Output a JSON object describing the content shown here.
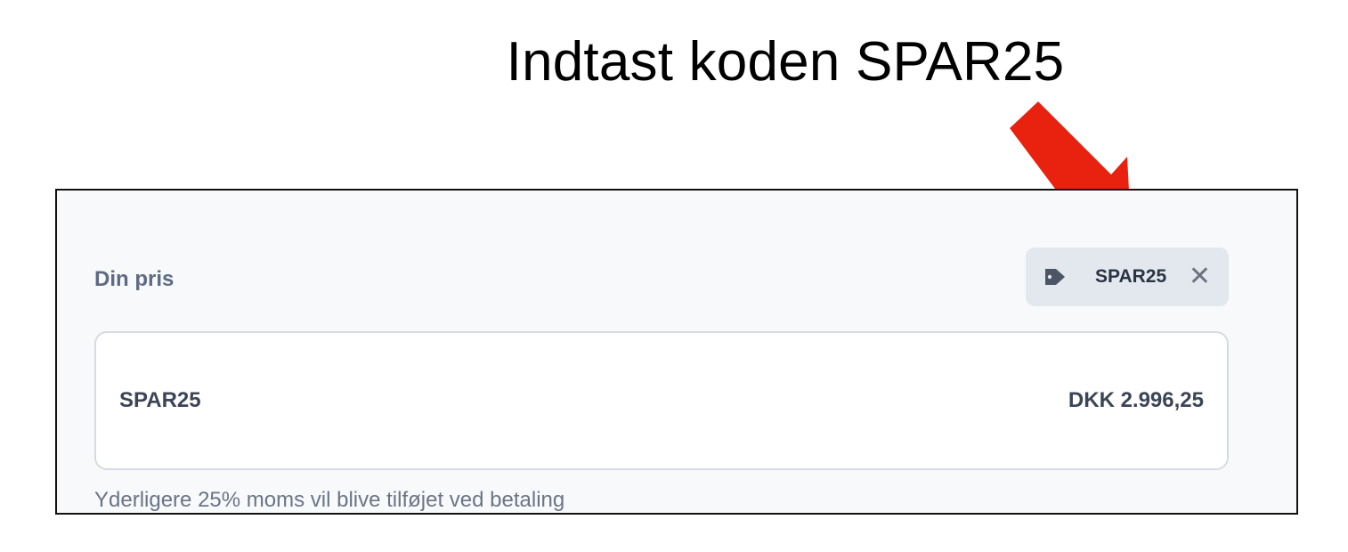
{
  "headline": "Indtast koden SPAR25",
  "annotation": {
    "icon": "arrow-down-right-icon",
    "color": "#e8220f"
  },
  "price_section": {
    "label": "Din pris",
    "coupon": {
      "icon": "tag-icon",
      "code": "SPAR25",
      "remove_icon": "close-icon",
      "remove_symbol": "✕"
    },
    "line_item": {
      "name": "SPAR25",
      "amount": "DKK 2.996,25"
    },
    "vat_note": "Yderligere 25% moms vil blive tilføjet ved betaling"
  },
  "colors": {
    "arrow": "#e8220f",
    "label_text": "#5e6b82",
    "coupon_bg": "#e3e8ef",
    "panel_bg": "#f8f9fb"
  }
}
